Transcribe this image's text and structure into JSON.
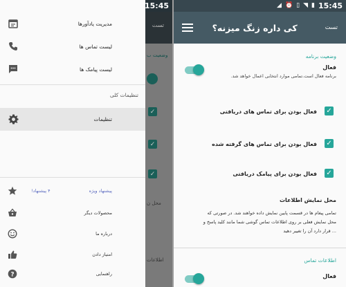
{
  "status_bar": {
    "time": "15:45"
  },
  "settings": {
    "app_title": "کی داره زنگ میزنه؟",
    "test_label": "تست",
    "section_app_status": "وضعیت برنامه",
    "active_label": "فعال",
    "active_desc": "برنامه فعال است.تمامی موارد انتخابی اعمال خواهد شد.",
    "check_incoming_calls": "فعال بودن برای تماس های دریافتی",
    "check_outgoing_calls": "فعال بودن برای تماس های گرفته شده",
    "check_incoming_sms": "فعال بودن برای پیامک دریافتی",
    "display_title": "محل نمایش اطلاعات",
    "display_desc_1": "تمامی پیغام ها در قسمت پایین نمایش داده خواهند شد. در صورتی که",
    "display_desc_2": "محل نمایش فعلی بر روی اطلاعات تماس گوشی شما مانند کلید پاسخ و",
    "display_desc_3": "... قرار دارد آن را تغییر دهید",
    "section_contact_info": "اطلاعات تماس",
    "active_label_2": "فعال",
    "switch_active_on": true,
    "switch_active_2_on": true
  },
  "drawer": {
    "items": [
      {
        "label": "مدیریت یادآورها",
        "icon": "calendar-icon"
      },
      {
        "label": "لیست تماس ها",
        "icon": "phone-icon"
      },
      {
        "label": "لیست پیامک ها",
        "icon": "message-icon"
      }
    ],
    "section_other_settings": "تنظیمات کلی",
    "settings_item": {
      "label": "تنظیمات",
      "icon": "gear-icon"
    },
    "bottom_items": [
      {
        "label": "پیشنهاد ویژه",
        "icon": "star-icon",
        "badge": "۴ پیشنهاد!"
      },
      {
        "label": "محصولات دیگر",
        "icon": "basket-icon"
      },
      {
        "label": "درباره ما",
        "icon": "smiley-icon"
      },
      {
        "label": "امتیاز دادن",
        "icon": "thumbs-up-icon"
      },
      {
        "label": "راهنمایی",
        "icon": "help-icon"
      }
    ],
    "background": {
      "test_label": "تست",
      "partial_title": "وضعیت ب",
      "partial_display": "محل ن",
      "partial_contact": "اطلاعات"
    }
  }
}
